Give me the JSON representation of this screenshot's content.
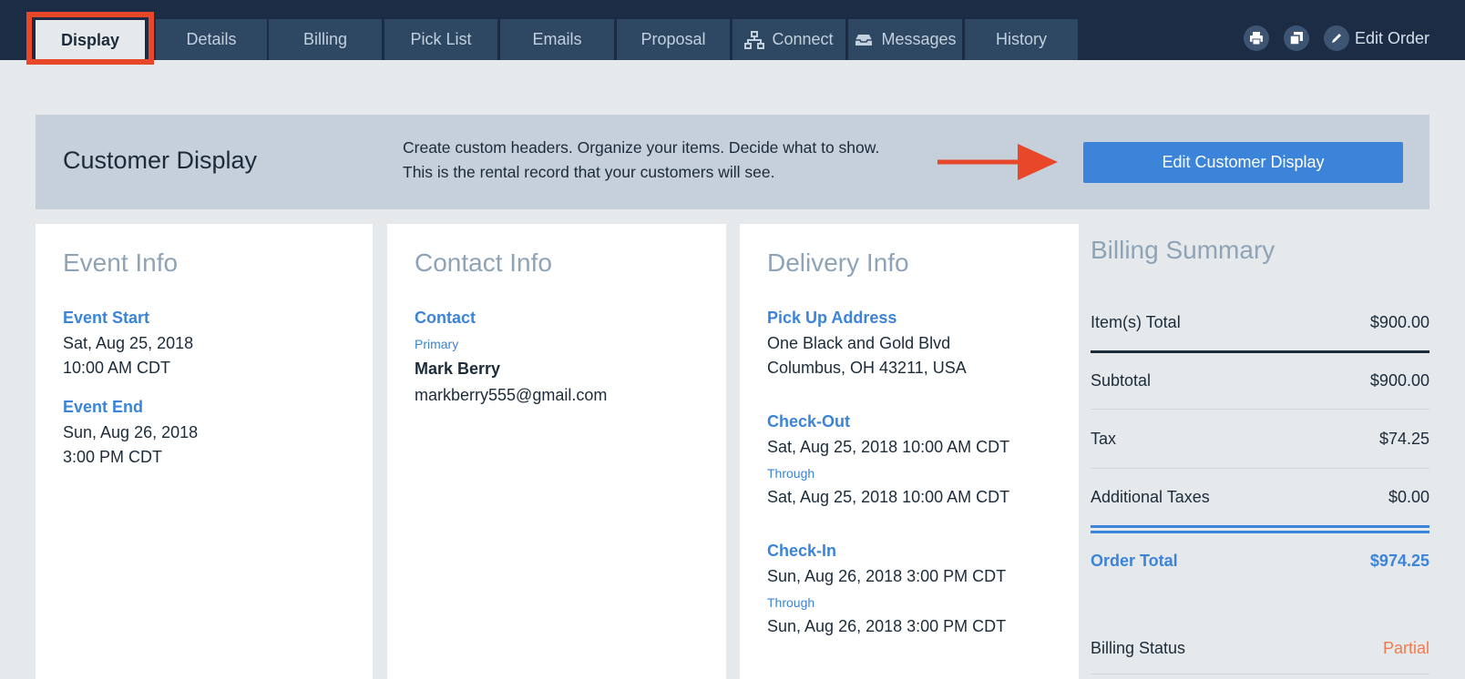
{
  "nav": {
    "tabs": [
      {
        "label": "Display",
        "icon": null
      },
      {
        "label": "Details",
        "icon": null
      },
      {
        "label": "Billing",
        "icon": null
      },
      {
        "label": "Pick List",
        "icon": null
      },
      {
        "label": "Emails",
        "icon": null
      },
      {
        "label": "Proposal",
        "icon": null
      },
      {
        "label": "Connect",
        "icon": "network-icon"
      },
      {
        "label": "Messages",
        "icon": "inbox-icon"
      },
      {
        "label": "History",
        "icon": null
      }
    ],
    "active_tab": "Display",
    "actions": {
      "print_icon": "print-icon",
      "duplicate_icon": "duplicate-icon",
      "edit_icon": "pencil-icon",
      "edit_label": "Edit Order"
    }
  },
  "banner": {
    "title": "Customer Display",
    "desc_line1": "Create custom headers. Organize your items. Decide what to show.",
    "desc_line2": "This is the rental record that your customers will see.",
    "button_label": "Edit Customer Display"
  },
  "event_info": {
    "title": "Event Info",
    "start_label": "Event Start",
    "start_date": "Sat, Aug 25, 2018",
    "start_time": "10:00 AM CDT",
    "end_label": "Event End",
    "end_date": "Sun, Aug 26, 2018",
    "end_time": "3:00 PM CDT"
  },
  "contact_info": {
    "title": "Contact Info",
    "label": "Contact",
    "role": "Primary",
    "name": "Mark Berry",
    "email": "markberry555@gmail.com"
  },
  "delivery_info": {
    "title": "Delivery Info",
    "pickup_label": "Pick Up Address",
    "address_line1": "One Black and Gold Blvd",
    "address_line2": "Columbus, OH 43211, USA",
    "checkout_label": "Check-Out",
    "checkout_start": "Sat, Aug 25, 2018 10:00 AM CDT",
    "checkout_through": "Through",
    "checkout_end": "Sat, Aug 25, 2018 10:00 AM CDT",
    "checkin_label": "Check-In",
    "checkin_start": "Sun, Aug 26, 2018 3:00 PM CDT",
    "checkin_through": "Through",
    "checkin_end": "Sun, Aug 26, 2018 3:00 PM CDT"
  },
  "billing_summary": {
    "title": "Billing Summary",
    "items_total_label": "Item(s) Total",
    "items_total": "$900.00",
    "subtotal_label": "Subtotal",
    "subtotal": "$900.00",
    "tax_label": "Tax",
    "tax": "$74.25",
    "additional_taxes_label": "Additional Taxes",
    "additional_taxes": "$0.00",
    "order_total_label": "Order Total",
    "order_total": "$974.25",
    "status_label": "Billing Status",
    "status": "Partial"
  },
  "colors": {
    "nav_bg": "#1b2c44",
    "tab_bg": "#2e4763",
    "accent": "#3b84d9",
    "highlight": "#e8472a",
    "partial": "#f07a4d"
  }
}
